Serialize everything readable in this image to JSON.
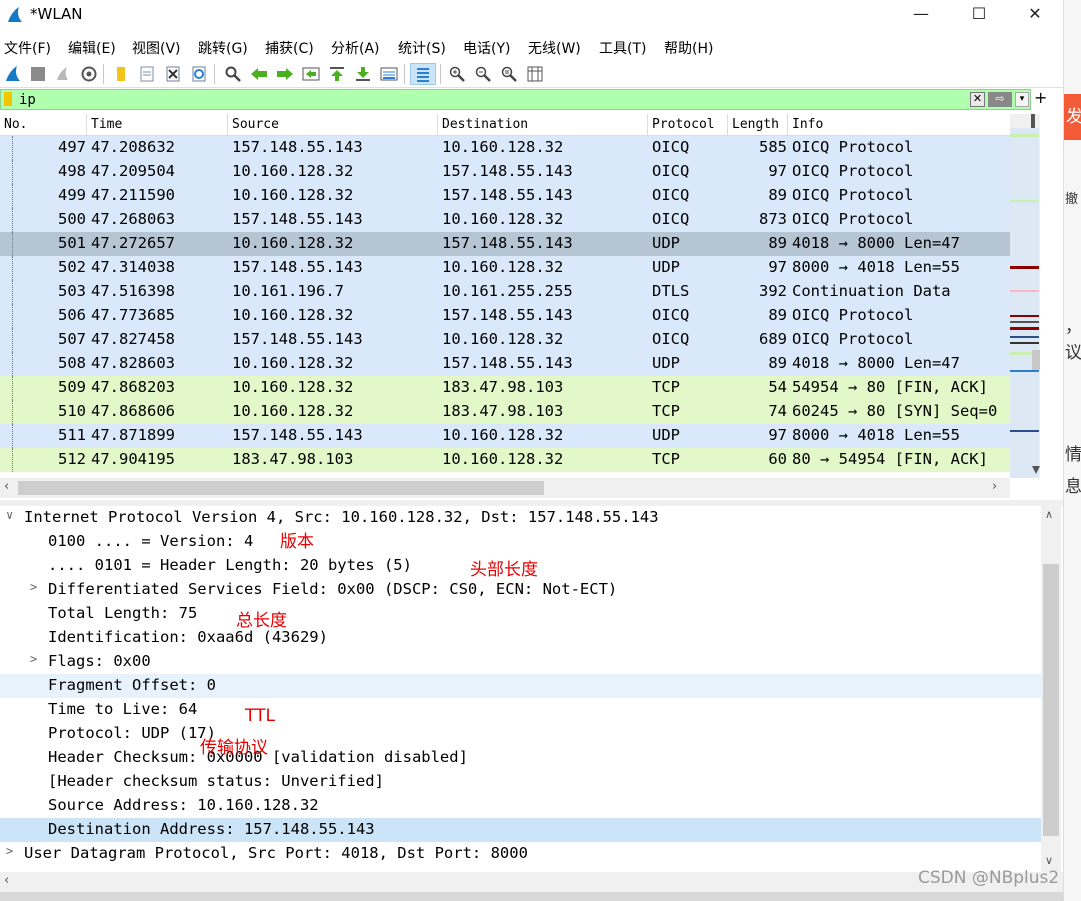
{
  "window": {
    "title": "*WLAN",
    "minimize": "—",
    "maximize": "☐",
    "close": "✕"
  },
  "menu": [
    "文件(F)",
    "编辑(E)",
    "视图(V)",
    "跳转(G)",
    "捕获(C)",
    "分析(A)",
    "统计(S)",
    "电话(Y)",
    "无线(W)",
    "工具(T)",
    "帮助(H)"
  ],
  "filter": {
    "value": "ip",
    "apply_symbol": "⇨",
    "dropdown_symbol": "▾",
    "add_symbol": "+",
    "clear_symbol": "✕"
  },
  "packet_list": {
    "columns": [
      "No.",
      "Time",
      "Source",
      "Destination",
      "Protocol",
      "Length",
      "Info"
    ],
    "rows": [
      {
        "no": "497",
        "time": "47.208632",
        "src": "157.148.55.143",
        "dst": "10.160.128.32",
        "proto": "OICQ",
        "len": "585",
        "info": "OICQ Protocol",
        "bg": "#d9e9fb"
      },
      {
        "no": "498",
        "time": "47.209504",
        "src": "10.160.128.32",
        "dst": "157.148.55.143",
        "proto": "OICQ",
        "len": "97",
        "info": "OICQ Protocol",
        "bg": "#d9e9fb"
      },
      {
        "no": "499",
        "time": "47.211590",
        "src": "10.160.128.32",
        "dst": "157.148.55.143",
        "proto": "OICQ",
        "len": "89",
        "info": "OICQ Protocol",
        "bg": "#d9e9fb"
      },
      {
        "no": "500",
        "time": "47.268063",
        "src": "157.148.55.143",
        "dst": "10.160.128.32",
        "proto": "OICQ",
        "len": "873",
        "info": "OICQ Protocol",
        "bg": "#d9e9fb"
      },
      {
        "no": "501",
        "time": "47.272657",
        "src": "10.160.128.32",
        "dst": "157.148.55.143",
        "proto": "UDP",
        "len": "89",
        "info": "4018 → 8000 Len=47",
        "bg": "#b6c5d4"
      },
      {
        "no": "502",
        "time": "47.314038",
        "src": "157.148.55.143",
        "dst": "10.160.128.32",
        "proto": "UDP",
        "len": "97",
        "info": "8000 → 4018 Len=55",
        "bg": "#d9e9fb"
      },
      {
        "no": "503",
        "time": "47.516398",
        "src": "10.161.196.7",
        "dst": "10.161.255.255",
        "proto": "DTLS",
        "len": "392",
        "info": "Continuation Data",
        "bg": "#d9e9fb"
      },
      {
        "no": "506",
        "time": "47.773685",
        "src": "10.160.128.32",
        "dst": "157.148.55.143",
        "proto": "OICQ",
        "len": "89",
        "info": "OICQ Protocol",
        "bg": "#d9e9fb"
      },
      {
        "no": "507",
        "time": "47.827458",
        "src": "157.148.55.143",
        "dst": "10.160.128.32",
        "proto": "OICQ",
        "len": "689",
        "info": "OICQ Protocol",
        "bg": "#d9e9fb"
      },
      {
        "no": "508",
        "time": "47.828603",
        "src": "10.160.128.32",
        "dst": "157.148.55.143",
        "proto": "UDP",
        "len": "89",
        "info": "4018 → 8000 Len=47",
        "bg": "#d9e9fb"
      },
      {
        "no": "509",
        "time": "47.868203",
        "src": "10.160.128.32",
        "dst": "183.47.98.103",
        "proto": "TCP",
        "len": "54",
        "info": "54954 → 80 [FIN, ACK]",
        "bg": "#e3f8c9"
      },
      {
        "no": "510",
        "time": "47.868606",
        "src": "10.160.128.32",
        "dst": "183.47.98.103",
        "proto": "TCP",
        "len": "74",
        "info": "60245 → 80 [SYN] Seq=0",
        "bg": "#e3f8c9"
      },
      {
        "no": "511",
        "time": "47.871899",
        "src": "157.148.55.143",
        "dst": "10.160.128.32",
        "proto": "UDP",
        "len": "97",
        "info": "8000 → 4018 Len=55",
        "bg": "#d9e9fb"
      },
      {
        "no": "512",
        "time": "47.904195",
        "src": "183.47.98.103",
        "dst": "10.160.128.32",
        "proto": "TCP",
        "len": "60",
        "info": "80 → 54954 [FIN, ACK]",
        "bg": "#e3f8c9"
      }
    ]
  },
  "details": {
    "lines": [
      {
        "text": "Internet Protocol Version 4, Src: 10.160.128.32, Dst: 157.148.55.143",
        "arrow": "∨",
        "level": 0,
        "hl": ""
      },
      {
        "text": "0100 .... = Version: 4",
        "arrow": "",
        "level": 1,
        "hl": ""
      },
      {
        "text": ".... 0101 = Header Length: 20 bytes (5)",
        "arrow": "",
        "level": 1,
        "hl": ""
      },
      {
        "text": "Differentiated Services Field: 0x00 (DSCP: CS0, ECN: Not-ECT)",
        "arrow": ">",
        "level": 1,
        "hl": ""
      },
      {
        "text": "Total Length: 75",
        "arrow": "",
        "level": 1,
        "hl": ""
      },
      {
        "text": "Identification: 0xaa6d (43629)",
        "arrow": "",
        "level": 1,
        "hl": ""
      },
      {
        "text": "Flags: 0x00",
        "arrow": ">",
        "level": 1,
        "hl": ""
      },
      {
        "text": "Fragment Offset: 0",
        "arrow": "",
        "level": 1,
        "hl": "light"
      },
      {
        "text": "Time to Live: 64",
        "arrow": "",
        "level": 1,
        "hl": ""
      },
      {
        "text": "Protocol: UDP (17)",
        "arrow": "",
        "level": 1,
        "hl": ""
      },
      {
        "text": "Header Checksum: 0x0000 [validation disabled]",
        "arrow": "",
        "level": 1,
        "hl": ""
      },
      {
        "text": "[Header checksum status: Unverified]",
        "arrow": "",
        "level": 1,
        "hl": ""
      },
      {
        "text": "Source Address: 10.160.128.32",
        "arrow": "",
        "level": 1,
        "hl": ""
      },
      {
        "text": "Destination Address: 157.148.55.143",
        "arrow": "",
        "level": 1,
        "hl": "selected"
      },
      {
        "text": "User Datagram Protocol, Src Port: 4018, Dst Port: 8000",
        "arrow": ">",
        "level": 0,
        "hl": ""
      }
    ]
  },
  "annotations": {
    "version": "版本",
    "header_length": "头部长度",
    "total_length": "总长度",
    "ttl": "TTL",
    "protocol": "传输协议"
  },
  "right_page": {
    "orange_text": "发",
    "t1": "撤",
    "t2": "，",
    "t3": "议",
    "t4": "情",
    "t5": "息"
  },
  "watermark": "CSDN @NBplus2",
  "colors": {
    "filter_ok": "#afffaf",
    "udp_row": "#d9e9fb",
    "tcp_row": "#e3f8c9",
    "selected_row": "#b6c5d4",
    "annotation": "#e60000"
  }
}
